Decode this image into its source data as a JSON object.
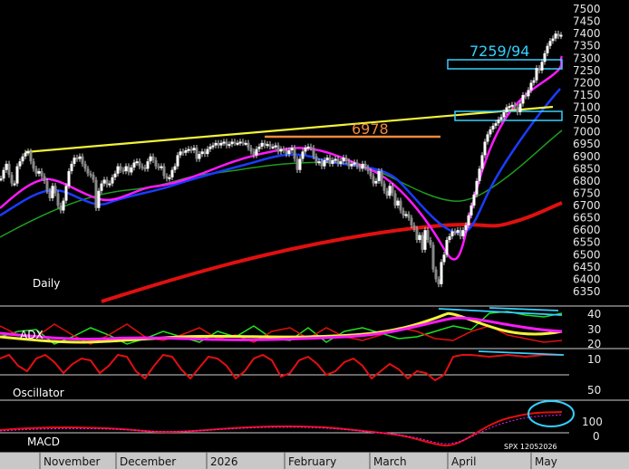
{
  "chart_data": {
    "type": "candlestick",
    "panels": [
      "Daily",
      "ADX",
      "Oscillator",
      "MACD"
    ],
    "price_axis": {
      "ticks": [
        7500,
        7450,
        7400,
        7350,
        7300,
        7250,
        7200,
        7150,
        7100,
        7050,
        7000,
        6950,
        6900,
        6850,
        6800,
        6750,
        6700,
        6650,
        6600,
        6550,
        6500,
        6450,
        6400,
        6350
      ],
      "ylim": [
        6310,
        7520
      ]
    },
    "adx_axis": {
      "ticks": [
        40,
        30,
        20,
        10
      ]
    },
    "oscillator_axis": {
      "ticks": [
        50
      ]
    },
    "macd_axis": {
      "ticks": [
        100,
        0
      ]
    },
    "x_axis": {
      "months": [
        "November",
        "December",
        "2026",
        "February",
        "March",
        "April",
        "May"
      ]
    },
    "annotations": {
      "target_1": "7259/94",
      "resistance_1": "6978",
      "footer": "SPX 12052026"
    },
    "series": [
      {
        "name": "candles",
        "points": [
          [
            1,
            6810
          ],
          [
            4,
            6845
          ],
          [
            7,
            6870
          ],
          [
            10,
            6825
          ],
          [
            13,
            6790
          ],
          [
            16,
            6790
          ],
          [
            19,
            6860
          ],
          [
            22,
            6880
          ],
          [
            25,
            6900
          ],
          [
            28,
            6915
          ],
          [
            31,
            6920
          ],
          [
            34,
            6880
          ],
          [
            37,
            6850
          ],
          [
            40,
            6830
          ],
          [
            43,
            6840
          ],
          [
            46,
            6820
          ],
          [
            49,
            6800
          ],
          [
            52,
            6760
          ],
          [
            55,
            6730
          ],
          [
            58,
            6780
          ],
          [
            61,
            6750
          ],
          [
            64,
            6700
          ],
          [
            67,
            6680
          ],
          [
            70,
            6720
          ],
          [
            73,
            6780
          ],
          [
            76,
            6840
          ],
          [
            79,
            6870
          ],
          [
            82,
            6895
          ],
          [
            85,
            6890
          ],
          [
            88,
            6900
          ],
          [
            91,
            6870
          ],
          [
            94,
            6850
          ],
          [
            97,
            6830
          ],
          [
            100,
            6825
          ],
          [
            103,
            6805
          ],
          [
            106,
            6690
          ],
          [
            109,
            6760
          ],
          [
            112,
            6790
          ],
          [
            115,
            6805
          ],
          [
            118,
            6785
          ],
          [
            121,
            6790
          ],
          [
            124,
            6815
          ],
          [
            127,
            6830
          ],
          [
            130,
            6860
          ],
          [
            133,
            6845
          ],
          [
            136,
            6840
          ],
          [
            139,
            6860
          ],
          [
            142,
            6835
          ],
          [
            145,
            6855
          ],
          [
            148,
            6875
          ],
          [
            151,
            6880
          ],
          [
            154,
            6860
          ],
          [
            157,
            6855
          ],
          [
            160,
            6850
          ],
          [
            163,
            6880
          ],
          [
            166,
            6900
          ],
          [
            169,
            6885
          ],
          [
            172,
            6860
          ],
          [
            175,
            6855
          ],
          [
            178,
            6860
          ],
          [
            181,
            6820
          ],
          [
            184,
            6810
          ],
          [
            187,
            6815
          ],
          [
            190,
            6845
          ],
          [
            193,
            6860
          ],
          [
            196,
            6905
          ],
          [
            199,
            6920
          ],
          [
            202,
            6915
          ],
          [
            205,
            6925
          ],
          [
            208,
            6930
          ],
          [
            211,
            6925
          ],
          [
            214,
            6935
          ],
          [
            217,
            6890
          ],
          [
            220,
            6910
          ],
          [
            223,
            6920
          ],
          [
            226,
            6910
          ],
          [
            229,
            6930
          ],
          [
            232,
            6940
          ],
          [
            235,
            6945
          ],
          [
            238,
            6955
          ],
          [
            241,
            6945
          ],
          [
            244,
            6955
          ],
          [
            247,
            6960
          ],
          [
            250,
            6945
          ],
          [
            253,
            6950
          ],
          [
            256,
            6960
          ],
          [
            259,
            6955
          ],
          [
            262,
            6955
          ],
          [
            265,
            6960
          ],
          [
            268,
            6955
          ],
          [
            271,
            6955
          ],
          [
            274,
            6935
          ],
          [
            277,
            6920
          ],
          [
            280,
            6905
          ],
          [
            283,
            6930
          ],
          [
            286,
            6940
          ],
          [
            289,
            6955
          ],
          [
            292,
            6945
          ],
          [
            295,
            6950
          ],
          [
            298,
            6940
          ],
          [
            301,
            6940
          ],
          [
            304,
            6945
          ],
          [
            307,
            6920
          ],
          [
            310,
            6930
          ],
          [
            313,
            6925
          ],
          [
            316,
            6910
          ],
          [
            319,
            6925
          ],
          [
            322,
            6935
          ],
          [
            325,
            6890
          ],
          [
            328,
            6845
          ],
          [
            331,
            6890
          ],
          [
            334,
            6920
          ],
          [
            337,
            6935
          ],
          [
            340,
            6940
          ],
          [
            343,
            6935
          ],
          [
            346,
            6900
          ],
          [
            349,
            6875
          ],
          [
            352,
            6880
          ],
          [
            355,
            6860
          ],
          [
            358,
            6885
          ],
          [
            361,
            6895
          ],
          [
            364,
            6870
          ],
          [
            367,
            6885
          ],
          [
            370,
            6890
          ],
          [
            373,
            6870
          ],
          [
            376,
            6880
          ],
          [
            379,
            6895
          ],
          [
            382,
            6880
          ],
          [
            385,
            6860
          ],
          [
            388,
            6870
          ],
          [
            391,
            6875
          ],
          [
            394,
            6860
          ],
          [
            397,
            6850
          ],
          [
            400,
            6870
          ],
          [
            403,
            6855
          ],
          [
            406,
            6840
          ],
          [
            409,
            6820
          ],
          [
            412,
            6790
          ],
          [
            415,
            6800
          ],
          [
            418,
            6840
          ],
          [
            421,
            6790
          ],
          [
            424,
            6760
          ],
          [
            427,
            6740
          ],
          [
            430,
            6780
          ],
          [
            433,
            6750
          ],
          [
            436,
            6700
          ],
          [
            439,
            6720
          ],
          [
            442,
            6680
          ],
          [
            445,
            6660
          ],
          [
            448,
            6665
          ],
          [
            451,
            6650
          ],
          [
            454,
            6620
          ],
          [
            457,
            6605
          ],
          [
            460,
            6560
          ],
          [
            463,
            6580
          ],
          [
            466,
            6520
          ],
          [
            469,
            6600
          ],
          [
            472,
            6560
          ],
          [
            475,
            6540
          ],
          [
            478,
            6440
          ],
          [
            481,
            6400
          ],
          [
            484,
            6380
          ],
          [
            487,
            6470
          ],
          [
            490,
            6500
          ],
          [
            493,
            6560
          ],
          [
            496,
            6575
          ],
          [
            499,
            6595
          ],
          [
            502,
            6590
          ],
          [
            505,
            6600
          ],
          [
            508,
            6575
          ],
          [
            511,
            6600
          ],
          [
            514,
            6620
          ],
          [
            517,
            6660
          ],
          [
            520,
            6700
          ],
          [
            523,
            6745
          ],
          [
            526,
            6800
          ],
          [
            529,
            6850
          ],
          [
            532,
            6905
          ],
          [
            535,
            6960
          ],
          [
            538,
            6990
          ],
          [
            541,
            7010
          ],
          [
            544,
            7025
          ],
          [
            547,
            7035
          ],
          [
            550,
            7050
          ],
          [
            553,
            7060
          ],
          [
            556,
            7080
          ],
          [
            559,
            7100
          ],
          [
            562,
            7105
          ],
          [
            565,
            7110
          ],
          [
            568,
            7100
          ],
          [
            571,
            7080
          ],
          [
            574,
            7115
          ],
          [
            577,
            7150
          ],
          [
            580,
            7145
          ],
          [
            583,
            7170
          ],
          [
            586,
            7200
          ],
          [
            589,
            7210
          ],
          [
            592,
            7260
          ],
          [
            595,
            7250
          ],
          [
            598,
            7285
          ],
          [
            601,
            7320
          ],
          [
            604,
            7350
          ],
          [
            607,
            7370
          ],
          [
            610,
            7380
          ],
          [
            613,
            7400
          ],
          [
            616,
            7390
          ],
          [
            619,
            7395
          ]
        ]
      }
    ]
  }
}
